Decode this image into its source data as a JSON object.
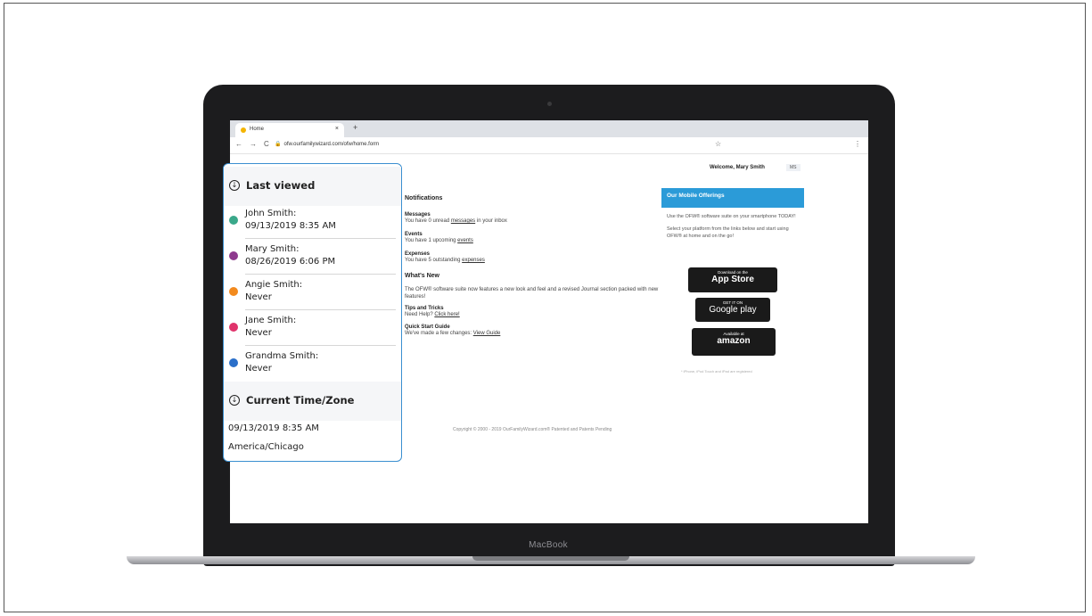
{
  "laptop": {
    "brand_label": "MacBook"
  },
  "browser": {
    "tab_title": "Home",
    "tab_close": "×",
    "new_tab": "+",
    "nav_back": "←",
    "nav_forward": "→",
    "nav_reload": "C",
    "url": "ofw.ourfamilywizard.com/ofw/home.form",
    "bookmark_star": "☆",
    "menu": "⋮"
  },
  "header": {
    "welcome": "Welcome, Mary Smith",
    "lang_badge": "MS"
  },
  "notifications": {
    "title": "Notifications",
    "messages": {
      "heading": "Messages",
      "prefix": "You have 0 unread ",
      "link": "messages",
      "suffix": " in your inbox"
    },
    "events": {
      "heading": "Events",
      "prefix": "You have 1 upcoming ",
      "link": "events"
    },
    "expenses": {
      "heading": "Expenses",
      "prefix": "You have 5 outstanding ",
      "link": "expenses"
    }
  },
  "whats_new": {
    "title": "What's New",
    "text": "The OFW® software suite now features a new look and feel and a revised Journal section packed with new features!",
    "tips_heading": "Tips and Tricks",
    "tips_prefix": "Need Help? ",
    "tips_link": "Click here!",
    "guide_heading": "Quick Start Guide",
    "guide_prefix": "We've made a few changes: ",
    "guide_link": "View Guide"
  },
  "footer": {
    "copyright": "Copyright © 2000 - 2019 OurFamilyWizard.com® Patented and Patents Pending"
  },
  "mobile": {
    "title": "Our Mobile Offerings",
    "line1": "Use the OFW® software suite on your smartphone TODAY!",
    "line2": "Select your platform from the links below and start using OFW® at home and on the go!",
    "appstore_small": "Download on the",
    "appstore_big": "App Store",
    "google_small": "GET IT ON",
    "google_big": "Google play",
    "amazon_small": "Available at",
    "amazon_big": "amazon",
    "foot": "* iPhone, iPod Touch and iPad are registered"
  },
  "panel": {
    "last_viewed_title": "Last viewed",
    "items": [
      {
        "name": "John Smith:",
        "when": "09/13/2019 8:35 AM",
        "color": "#3aa88a"
      },
      {
        "name": "Mary Smith:",
        "when": "08/26/2019 6:06 PM",
        "color": "#8e3a8e"
      },
      {
        "name": "Angie Smith:",
        "when": "Never",
        "color": "#f28a1e"
      },
      {
        "name": "Jane Smith:",
        "when": "Never",
        "color": "#e0336b"
      },
      {
        "name": "Grandma Smith:",
        "when": "Never",
        "color": "#2a6fc9"
      }
    ],
    "time_title": "Current Time/Zone",
    "current_time": "09/13/2019 8:35 AM",
    "timezone": "America/Chicago"
  }
}
